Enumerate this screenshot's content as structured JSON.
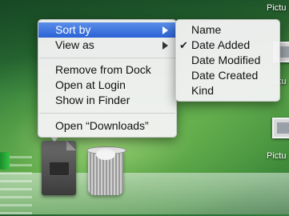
{
  "context_menu": {
    "items": [
      {
        "label": "Sort by",
        "has_submenu": true,
        "selected": true
      },
      {
        "label": "View as",
        "has_submenu": true,
        "selected": false
      },
      {
        "label": "Remove from Dock"
      },
      {
        "label": "Open at Login"
      },
      {
        "label": "Show in Finder"
      },
      {
        "label": "Open “Downloads”"
      }
    ]
  },
  "submenu": {
    "items": [
      {
        "label": "Name",
        "checked": false
      },
      {
        "label": "Date Added",
        "checked": true
      },
      {
        "label": "Date Modified",
        "checked": false
      },
      {
        "label": "Date Created",
        "checked": false
      },
      {
        "label": "Kind",
        "checked": false
      }
    ],
    "check_glyph": "✔"
  },
  "desktop": {
    "icons": [
      {
        "label": "Pictu",
        "icon": "picture-file-icon"
      },
      {
        "label": "Pictu",
        "icon": "picture-file-icon"
      },
      {
        "label": "Pictu",
        "icon": "picture-file-icon"
      }
    ]
  },
  "dock": {
    "items": [
      {
        "name": "downloads-stack",
        "icon": "downloads-folder-icon"
      },
      {
        "name": "trash",
        "icon": "trash-icon"
      }
    ]
  },
  "colors": {
    "highlight": "#2a62d6",
    "desktop_green": "#3e8a3a"
  }
}
